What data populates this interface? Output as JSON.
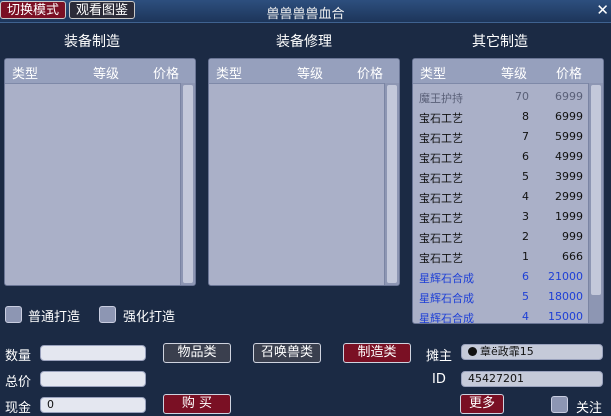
{
  "titlebar": {
    "switch_mode": "切换模式",
    "view_catalog": "观看图鉴",
    "title": "兽兽兽兽血合",
    "close": "✕"
  },
  "sections": {
    "equip_make": "装备制造",
    "equip_repair": "装备修理",
    "other_make": "其它制造"
  },
  "columns": {
    "type": "类型",
    "level": "等级",
    "price": "价格"
  },
  "other_items": [
    {
      "type": "魔王护持",
      "level": "70",
      "price": "6999",
      "style": "dim"
    },
    {
      "type": "宝石工艺",
      "level": "8",
      "price": "6999",
      "style": "norm"
    },
    {
      "type": "宝石工艺",
      "level": "7",
      "price": "5999",
      "style": "norm"
    },
    {
      "type": "宝石工艺",
      "level": "6",
      "price": "4999",
      "style": "norm"
    },
    {
      "type": "宝石工艺",
      "level": "5",
      "price": "3999",
      "style": "norm"
    },
    {
      "type": "宝石工艺",
      "level": "4",
      "price": "2999",
      "style": "norm"
    },
    {
      "type": "宝石工艺",
      "level": "3",
      "price": "1999",
      "style": "norm"
    },
    {
      "type": "宝石工艺",
      "level": "2",
      "price": "999",
      "style": "norm"
    },
    {
      "type": "宝石工艺",
      "level": "1",
      "price": "666",
      "style": "norm"
    },
    {
      "type": "星辉石合成",
      "level": "6",
      "price": "21000",
      "style": "blue"
    },
    {
      "type": "星辉石合成",
      "level": "5",
      "price": "18000",
      "style": "blue"
    },
    {
      "type": "星辉石合成",
      "level": "4",
      "price": "15000",
      "style": "blue"
    }
  ],
  "options": {
    "normal_craft": "普通打造",
    "enhance_craft": "强化打造"
  },
  "form": {
    "quantity_label": "数量",
    "total_label": "总价",
    "cash_label": "现金",
    "cash_value": "0",
    "owner_label": "摊主",
    "owner_value": "章ё政霏15",
    "id_label": "ID",
    "id_value": "45427201",
    "follow_label": "关注"
  },
  "buttons": {
    "items": "物品类",
    "summon": "召唤兽类",
    "craft": "制造类",
    "buy": "购 买",
    "more": "更多"
  }
}
